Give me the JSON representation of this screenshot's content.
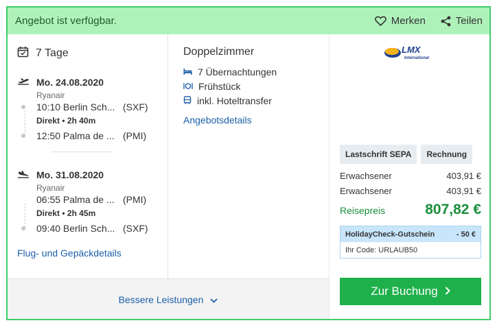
{
  "banner": {
    "text": "Angebot ist verfügbar.",
    "save_label": "Merken",
    "share_label": "Teilen"
  },
  "trip": {
    "duration": "7 Tage",
    "outbound": {
      "date": "Mo. 24.08.2020",
      "airline": "Ryanair",
      "depart_time_city": "10:10 Berlin Sch...",
      "depart_code": "(SXF)",
      "type": "Direkt",
      "duration": "2h 40m",
      "arrive_time_city": "12:50 Palma de ...",
      "arrive_code": "(PMI)"
    },
    "return": {
      "date": "Mo. 31.08.2020",
      "airline": "Ryanair",
      "depart_time_city": "06:55 Palma de ...",
      "depart_code": "(PMI)",
      "type": "Direkt",
      "duration": "2h 45m",
      "arrive_time_city": "09:40 Berlin Sch...",
      "arrive_code": "(SXF)"
    },
    "details_link": "Flug- und Gepäckdetails"
  },
  "room": {
    "title": "Doppelzimmer",
    "nights": "7 Übernachtungen",
    "board": "Frühstück",
    "transfer": "inkl. Hoteltransfer",
    "details_link": "Angebotsdetails"
  },
  "provider": {
    "logo_text": "LMX",
    "logo_subtext": "International"
  },
  "payment": {
    "methods": [
      "Lastschrift SEPA",
      "Rechnung"
    ]
  },
  "prices": {
    "travellers": [
      {
        "label": "Erwachsener",
        "price": "403,91 €"
      },
      {
        "label": "Erwachsener",
        "price": "403,91 €"
      }
    ],
    "total_label": "Reisepreis",
    "total_value": "807,82 €"
  },
  "voucher": {
    "title": "HolidayCheck-Gutschein",
    "discount": "- 50 €",
    "code_text": "Ihr Code: URLAUB50"
  },
  "book_button": "Zur Buchung",
  "more_services": "Bessere Leistungen",
  "colors": {
    "accent_green": "#1fb04c",
    "banner_bg": "#aef2b9",
    "link_blue": "#1d5fa8",
    "voucher_blue": "#c8e5fb"
  }
}
